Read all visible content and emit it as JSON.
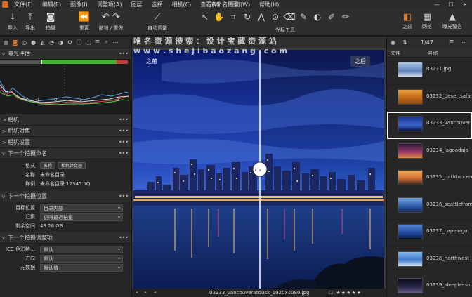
{
  "menubar": {
    "items": [
      "文件(F)",
      "编辑(E)",
      "图像(I)",
      "调整项(A)",
      "图层",
      "选择",
      "相机(C)",
      "查看(V)",
      "视窗(W)",
      "帮助(H)"
    ],
    "title": "未命名目录",
    "window_controls": [
      "—",
      "☐",
      "✕"
    ]
  },
  "toolbar": {
    "import": "导入",
    "export": "导出",
    "capture": "拍摄",
    "reset": "重置",
    "undo_redo": "撤销 / 重做",
    "auto_adjust": "自动调整",
    "cursor_tools": "光标工具",
    "after": "之前",
    "grid": "网格",
    "exposure_warning": "曝光警告"
  },
  "left_panel": {
    "exposure_section": "曝光评估",
    "scale_labels": [
      "-2",
      "-1",
      "0",
      "1",
      "2"
    ],
    "camera_section": "相机",
    "camera_focus_section": "相机对焦",
    "camera_settings_section": "相机设置",
    "next_naming_section": "下一个拍摄命名",
    "format_label": "格式",
    "format_tokens": [
      "名称",
      "相机计数器"
    ],
    "name_label": "名称",
    "name_value": "未命名目录",
    "sample_label": "样例",
    "sample_value": "未命名目录 12345.IIQ",
    "next_location_section": "下一个拍摄位置",
    "dest_label": "目标位置",
    "dest_value": "目录内部",
    "collection_label": "汇集",
    "collection_value": "仍限最近拍摄",
    "space_label": "剩余空间",
    "space_value": "43.26 GB",
    "next_adjust_section": "下一个拍摄调整项",
    "icc_label": "ICC 色彩特…",
    "icc_value": "默认",
    "orientation_label": "方向",
    "orientation_value": "默认",
    "metadata_label": "元数据",
    "metadata_value": "默认值"
  },
  "viewer": {
    "watermark_line1": "唯 名 资 源 搜 索 ： 设 计 宝 藏 资 源 站",
    "watermark_line2": "w w w . s h e j i b a o z a n g . c o m",
    "before_label": "之前",
    "after_label": "之后",
    "filename": "03233_vancouveratdusk_1920x1080.jpg",
    "rating": "☐ ★★★★★",
    "nav": "◂ ▸ ◂"
  },
  "right_panel": {
    "counter": "1/47",
    "col_file": "文件",
    "col_name": "名称",
    "items": [
      "03231.jpg",
      "03232_desertsafari",
      "03233_vancouver",
      "03234_lagoadaja",
      "03235_pathtoocea",
      "03236_seattlefrom",
      "03237_capeargo",
      "03238_northwest",
      "03239_sleeplessn"
    ],
    "selected_index": 2
  },
  "colors": {
    "accent": "#e07a2a",
    "panel": "#262626",
    "toolbar": "#2e2e2e"
  }
}
